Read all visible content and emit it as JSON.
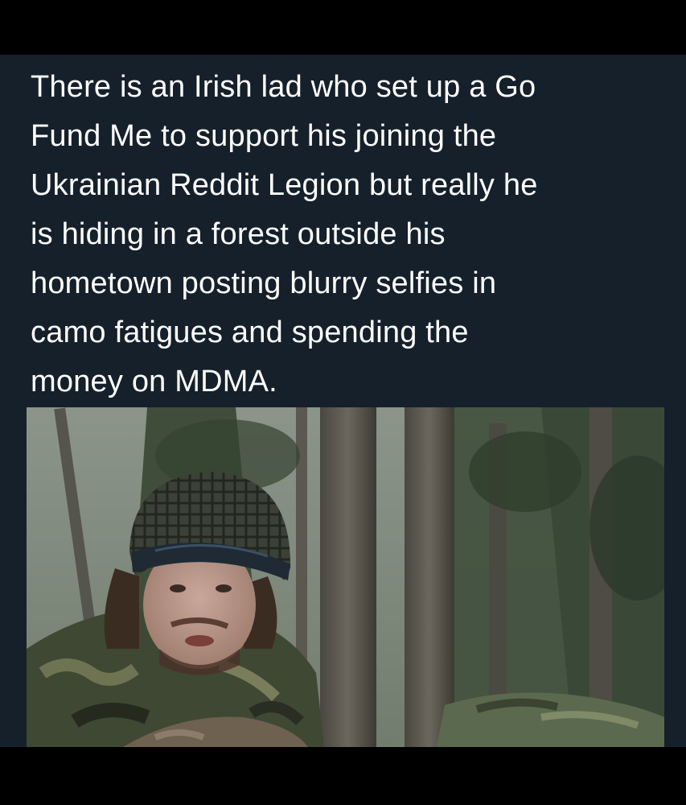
{
  "post": {
    "text_lines": [
      "There is an Irish lad who set up a Go",
      "Fund Me to support his joining the",
      "Ukrainian Reddit Legion but really he",
      "is hiding in a forest outside his",
      "hometown posting blurry selfies in",
      "camo fatigues and spending the",
      "money on MDMA."
    ],
    "photo": {
      "subject": "man in helmet and camouflage in a forest"
    }
  },
  "colors": {
    "background": "#15202b",
    "text": "#ffffff",
    "letterbox": "#000000"
  }
}
